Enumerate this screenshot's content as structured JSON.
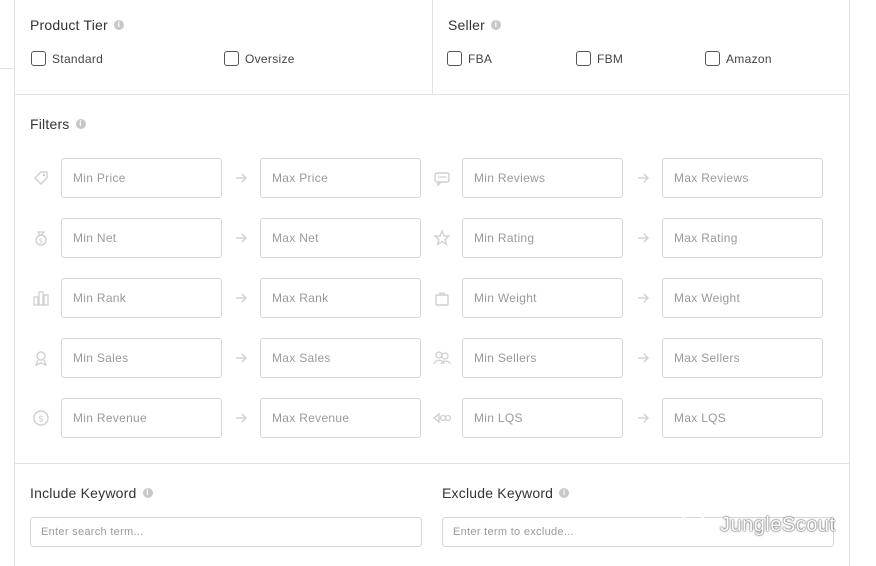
{
  "product_tier": {
    "title": "Product Tier",
    "options": [
      "Standard",
      "Oversize"
    ]
  },
  "seller": {
    "title": "Seller",
    "options": [
      "FBA",
      "FBM",
      "Amazon"
    ]
  },
  "filters": {
    "title": "Filters",
    "rows": [
      {
        "left_icon": "price-tag-icon",
        "min1": "Min Price",
        "max1": "Max Price",
        "right_icon": "reviews-icon",
        "min2": "Min Reviews",
        "max2": "Max Reviews"
      },
      {
        "left_icon": "money-bag-icon",
        "min1": "Min Net",
        "max1": "Max Net",
        "right_icon": "star-icon",
        "min2": "Min Rating",
        "max2": "Max Rating"
      },
      {
        "left_icon": "bar-chart-icon",
        "min1": "Min Rank",
        "max1": "Max Rank",
        "right_icon": "weight-icon",
        "min2": "Min Weight",
        "max2": "Max Weight"
      },
      {
        "left_icon": "sales-icon",
        "min1": "Min Sales",
        "max1": "Max Sales",
        "right_icon": "sellers-icon",
        "min2": "Min Sellers",
        "max2": "Max Sellers"
      },
      {
        "left_icon": "revenue-icon",
        "min1": "Min Revenue",
        "max1": "Max Revenue",
        "right_icon": "lqs-icon",
        "min2": "Min LQS",
        "max2": "Max LQS"
      }
    ]
  },
  "include_keyword": {
    "title": "Include Keyword",
    "placeholder": "Enter search term..."
  },
  "exclude_keyword": {
    "title": "Exclude Keyword",
    "placeholder": "Enter term to exclude..."
  },
  "watermark": {
    "text": "JungleScout"
  },
  "colors": {
    "border": "#e3e3e3",
    "input_border": "#d6d6d6",
    "icon": "#cfcfcf",
    "text": "#333333"
  }
}
